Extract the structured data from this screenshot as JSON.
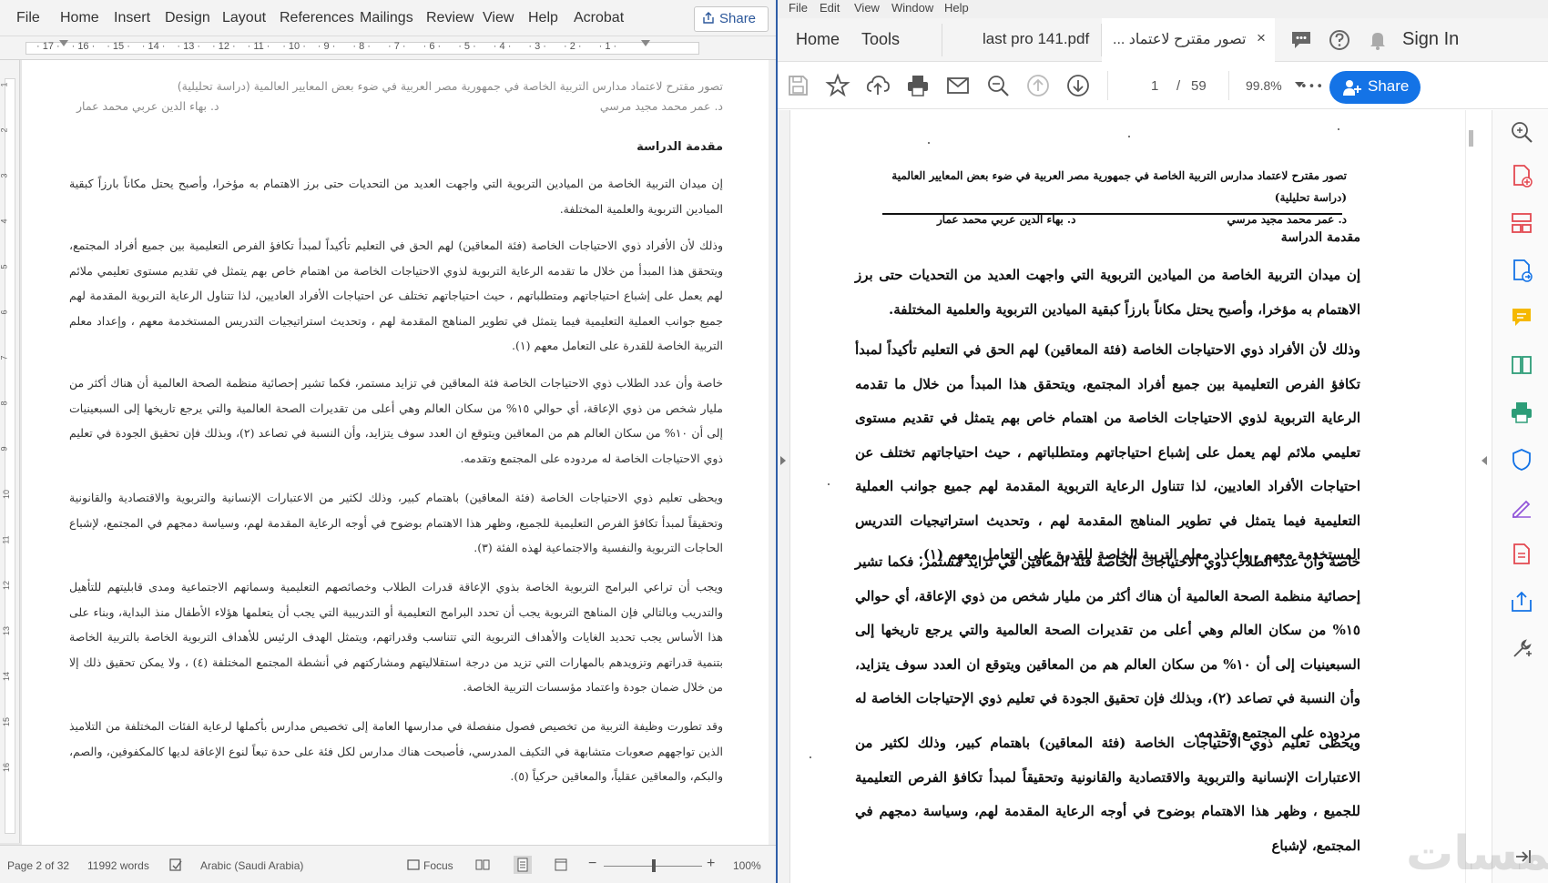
{
  "word": {
    "menu": [
      "File",
      "Home",
      "Insert",
      "Design",
      "Layout",
      "References",
      "Mailings",
      "Review",
      "View",
      "Help",
      "Acrobat"
    ],
    "share_label": "Share",
    "ruler_numbers": [
      "17",
      "16",
      "15",
      "14",
      "13",
      "12",
      "11",
      "10",
      "9",
      "8",
      "7",
      "6",
      "5",
      "4",
      "3",
      "2",
      "1"
    ],
    "vruler_numbers": [
      "1",
      "2",
      "3",
      "4",
      "5",
      "6",
      "7",
      "8",
      "9",
      "10",
      "11",
      "12",
      "13",
      "14",
      "15",
      "16"
    ],
    "doc": {
      "header_title": "تصور مقترح لاعتماد مدارس التربية الخاصة في جمهورية مصر العربية في ضوء بعض المعايير العالمية (دراسة تحليلية)",
      "author1": "د. عمر محمد مجيد مرسي",
      "author2": "د. بهاء الدين عربي محمد عمار",
      "heading": "مقدمة الدراسة",
      "paragraphs": [
        "إن ميدان التربية الخاصة من الميادين التربوية التي واجهت العديد من التحديات حتى برز الاهتمام به مؤخرا، وأصبح يحتل مكاناً بارزاً كبقية الميادين التربوية والعلمية المختلفة.",
        "وذلك لأن الأفراد ذوي الاحتياجات الخاصة (فئة المعاقين) لهم الحق في التعليم تأكيداً لمبدأ تكافؤ الفرص التعليمية بين جميع أفراد المجتمع، ويتحقق هذا المبدأ من خلال ما تقدمه الرعاية التربوية لذوي الاحتياجات الخاصة من اهتمام خاص بهم يتمثل في تقديم مستوى تعليمي ملائم لهم يعمل على إشباع احتياجاتهم ومتطلباتهم ، حيث احتياجاتهم تختلف عن احتياجات الأفراد العاديين، لذا تتناول الرعاية التربوية المقدمة لهم جميع جوانب العملية التعليمية فيما يتمثل في تطوير المناهج المقدمة لهم ، وتحديث استراتيجيات التدريس المستخدمة معهم ، وإعداد معلم التربية الخاصة للقدرة على التعامل معهم (١).",
        "خاصة وأن عدد الطلاب ذوي الاحتياجات الخاصة فئة المعاقين في تزايد مستمر، فكما تشير إحصائية منظمة الصحة العالمية أن هناك أكثر من مليار شخص من ذوي الإعاقة، أي حوالي ١٥% من سكان العالم وهي أعلى من تقديرات الصحة العالمية والتي يرجع تاريخها إلى السبعينيات إلى أن ١٠% من سكان العالم هم من المعاقين ويتوقع ان العدد سوف يتزايد، وأن النسبة في تصاعد (٢)، وبذلك فإن تحقيق الجودة في تعليم ذوي الاحتياجات الخاصة له مردوده على المجتمع وتقدمه.",
        "ويحظى تعليم ذوي الاحتياجات الخاصة (فئة المعاقين) باهتمام كبير، وذلك لكثير من الاعتبارات الإنسانية والتربوية والاقتصادية والقانونية وتحقيقاً لمبدأ تكافؤ الفرص التعليمية للجميع، وظهر هذا الاهتمام بوضوح في أوجه الرعاية المقدمة لهم، وسياسة دمجهم في المجتمع، لإشباع الحاجات التربوية والنفسية والاجتماعية لهذه الفئة (٣).",
        "ويجب أن تراعي البرامج التربوية الخاصة بذوي الإعاقة قدرات الطلاب وخصائصهم التعليمية وسماتهم الاجتماعية ومدى قابليتهم للتأهيل والتدريب وبالتالي فإن المناهج التربوية يجب أن تحدد البرامج التعليمية أو التدريبية التي يجب أن يتعلمها هؤلاء الأطفال منذ البداية، وبناء على هذا الأساس يجب تحديد الغايات والأهداف التربوية التي تتناسب وقدراتهم، ويتمثل الهدف الرئيس للأهداف التربوية الخاصة بالتربية الخاصة بتنمية قدراتهم وتزويدهم بالمهارات التي تزيد من درجة استقلاليتهم ومشاركتهم في أنشطة المجتمع المختلفة (٤) ، ولا يمكن تحقيق ذلك إلا من خلال ضمان جودة واعتماد مؤسسات التربية الخاصة.",
        "وقد تطورت وظيفة التربية من تخصيص فصول منفصلة في مدارسها العامة إلى تخصيص مدارس بأكملها لرعاية الفئات المختلفة من التلاميذ الذين تواجههم صعوبات متشابهة في التكيف المدرسي، فأصبحت هناك مدارس لكل فئة على حدة تبعاً لنوع الإعاقة لديها كالمكفوفين، والصم، والبكم، والمعاقين عقلياً، والمعاقين حركياً (٥)."
      ]
    },
    "status": {
      "page": "Page 2 of 32",
      "words": "11992 words",
      "language": "Arabic (Saudi Arabia)",
      "focus": "Focus",
      "zoom": "100%",
      "minus": "−",
      "plus": "+"
    }
  },
  "acrobat": {
    "menu": [
      "File",
      "Edit",
      "View",
      "Window",
      "Help"
    ],
    "tabs": {
      "home": "Home",
      "tools": "Tools",
      "doc1": "last pro 141.pdf",
      "doc2": "تصور مقترح لاعتماد ...",
      "close": "×"
    },
    "sign_in": "Sign In",
    "toolbar": {
      "page_current": "1",
      "page_sep": "/",
      "page_total": "59",
      "zoom": "99.8%",
      "more": "•••",
      "share": "Share"
    },
    "pdf": {
      "title": "تصور مقترح لاعتماد مدارس التربية الخاصة في جمهورية مصر العربية في ضوء بعض المعايير العالمية (دراسة تحليلية)",
      "author1": "د. عمر محمد مجيد مرسي",
      "author2": "د. بهاء الدين عربي محمد عمار",
      "heading": "مقدمة الدراسة",
      "paragraphs": [
        "إن ميدان التربية الخاصة من الميادين التربوية التي واجهت العديد من التحديات حتى برز الاهتمام به مؤخرا، وأصبح يحتل مكاناً بارزاً كبقية الميادين التربوية والعلمية المختلفة.",
        "وذلك لأن الأفراد ذوي الاحتياجات الخاصة (فئة المعاقين) لهم الحق في التعليم تأكيداً لمبدأ تكافؤ الفرص التعليمية بين جميع أفراد المجتمع، ويتحقق هذا المبدأ من خلال ما تقدمه الرعاية التربوية لذوي الاحتياجات الخاصة من اهتمام خاص بهم يتمثل في تقديم مستوى تعليمي ملائم لهم يعمل على إشباع احتياجاتهم ومتطلباتهم ، حيث احتياجاتهم تختلف عن احتياجات الأفراد العاديين، لذا تتناول الرعاية التربوية المقدمة لهم جميع جوانب العملية التعليمية فيما يتمثل في تطوير المناهج المقدمة لهم ، وتحديث استراتيجيات التدريس المستخدمة معهم ، وإعداد معلم التربية الخاصة للقدرة على التعامل معهم (١).",
        "خاصة وأن عدد الطلاب ذوي الاحتياجات الخاصة فئة المعاقين في تزايد مستمر، فكما تشير إحصائية منظمة الصحة العالمية أن هناك أكثر من مليار شخص من ذوي الإعاقة، أي حوالي ١٥% من سكان العالم وهي أعلى من تقديرات الصحة العالمية والتي يرجع تاريخها إلى السبعينيات إلى أن ١٠% من سكان العالم هم من المعاقين ويتوقع ان العدد سوف يتزايد، وأن النسبة في تصاعد (٢)، وبذلك فإن تحقيق الجودة في تعليم ذوي الإحتياجات الخاصة له مردوده على المجتمع وتقدمه.",
        "ويحظى تعليم ذوي الاحتياجات الخاصة (فئة المعاقين) باهتمام كبير، وذلك لكثير من الاعتبارات الإنسانية والتربوية والاقتصادية والقانونية وتحقيقاً لمبدأ تكافؤ الفرص التعليمية للجميع ، وظهر هذا الاهتمام بوضوح في أوجه الرعاية المقدمة لهم، وسياسة دمجهم في المجتمع، لإشباع"
      ]
    },
    "watermark": "خمسات"
  }
}
